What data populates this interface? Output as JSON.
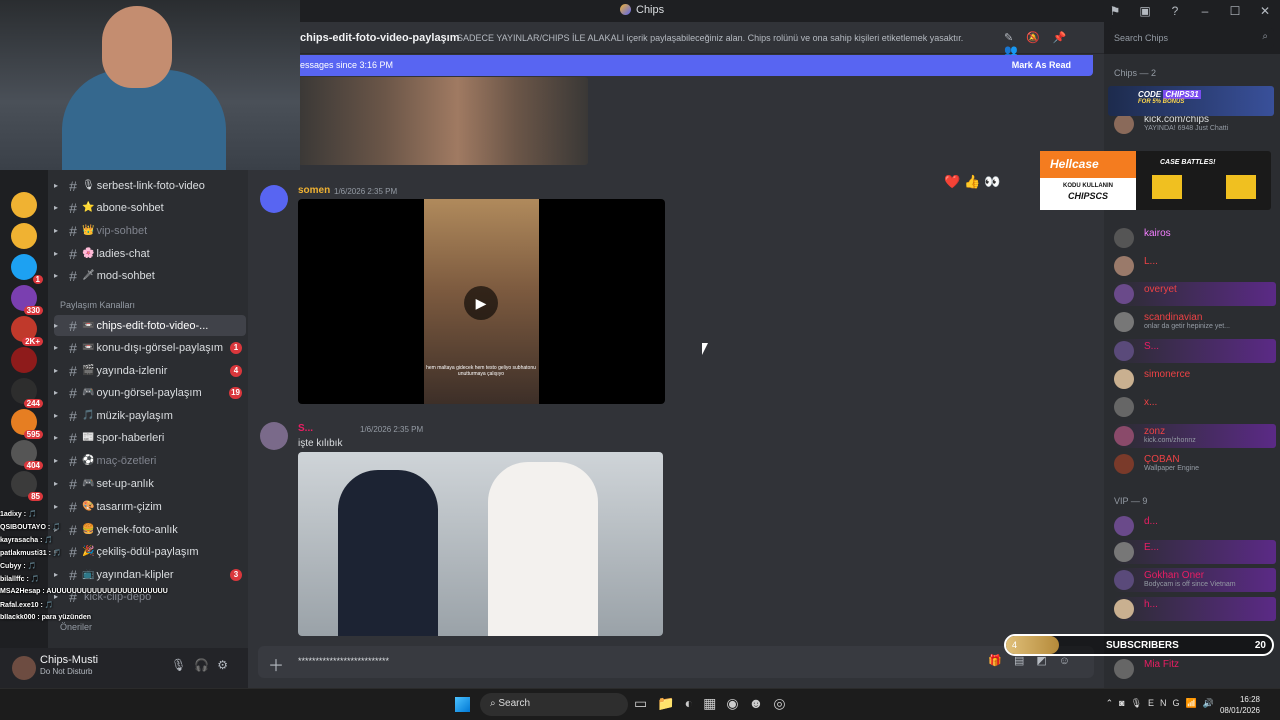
{
  "window": {
    "title": "Chips"
  },
  "header": {
    "channel_name": "chips-edit-foto-video-paylaşım",
    "topic": "SADECE YAYINLAR/CHIPS İLE ALAKALI içerik paylaşabileceğiniz alan. Chips rolünü ve ona sahip kişileri etiketlemek yasaktır.",
    "search_placeholder": "Search Chips"
  },
  "new_messages": {
    "label": "essages since 3:16 PM",
    "action": "Mark As Read"
  },
  "rail": [
    {
      "color": "#f0b232",
      "badge": ""
    },
    {
      "color": "#f0b232",
      "badge": ""
    },
    {
      "color": "#1da1f2",
      "badge": "1"
    },
    {
      "color": "#7a3fb0",
      "badge": "330"
    },
    {
      "color": "#c0392b",
      "badge": "2K+"
    },
    {
      "color": "#8e1b1b",
      "badge": ""
    },
    {
      "color": "#2d2d2d",
      "badge": "244"
    },
    {
      "color": "#e67e22",
      "badge": "595"
    },
    {
      "color": "#555555",
      "badge": "404"
    },
    {
      "color": "#3b3b3b",
      "badge": "85"
    }
  ],
  "channels": [
    {
      "emoji": "🎙",
      "name": "serbest-link-foto-video",
      "badge": "",
      "muted": false,
      "active": false
    },
    {
      "emoji": "⭐",
      "name": "abone-sohbet",
      "badge": "",
      "muted": false,
      "active": false
    },
    {
      "emoji": "👑",
      "name": "vip-sohbet",
      "badge": "",
      "muted": true,
      "active": false
    },
    {
      "emoji": "🌸",
      "name": "ladies-chat",
      "badge": "",
      "muted": false,
      "active": false
    },
    {
      "emoji": "🗡",
      "name": "mod-sohbet",
      "badge": "",
      "muted": false,
      "active": false
    },
    {
      "emoji": "📼",
      "name": "chips-edit-foto-video-...",
      "badge": "",
      "muted": false,
      "active": true
    },
    {
      "emoji": "📼",
      "name": "konu-dışı-görsel-paylaşım",
      "badge": "1",
      "muted": false,
      "active": false
    },
    {
      "emoji": "🎬",
      "name": "yayında-izlenir",
      "badge": "4",
      "muted": false,
      "active": false
    },
    {
      "emoji": "🎮",
      "name": "oyun-görsel-paylaşım",
      "badge": "19",
      "muted": false,
      "active": false
    },
    {
      "emoji": "🎵",
      "name": "müzik-paylaşım",
      "badge": "",
      "muted": false,
      "active": false
    },
    {
      "emoji": "📰",
      "name": "spor-haberleri",
      "badge": "",
      "muted": false,
      "active": false
    },
    {
      "emoji": "⚽",
      "name": "maç-özetleri",
      "badge": "",
      "muted": true,
      "active": false
    },
    {
      "emoji": "🎮",
      "name": "set-up-anlık",
      "badge": "",
      "muted": false,
      "active": false
    },
    {
      "emoji": "🎨",
      "name": "tasarım-çizim",
      "badge": "",
      "muted": false,
      "active": false
    },
    {
      "emoji": "🍔",
      "name": "yemek-foto-anlık",
      "badge": "",
      "muted": false,
      "active": false
    },
    {
      "emoji": "🎉",
      "name": "çekiliş-ödül-paylaşım",
      "badge": "",
      "muted": false,
      "active": false
    },
    {
      "emoji": "📺",
      "name": "yayından-klipler",
      "badge": "3",
      "muted": false,
      "active": false
    },
    {
      "emoji": "",
      "name": "kick-clip-depo",
      "badge": "",
      "muted": true,
      "active": false
    }
  ],
  "categories": {
    "share": "Paylaşım Kanalları",
    "suggestions": "Öneriler"
  },
  "user": {
    "name": "Chips-Musti",
    "status": "Do Not Disturb"
  },
  "messages": [
    {
      "author": "somen",
      "time": "1/6/2026 2:35 PM",
      "video_caption": "hem maltaya gidecek hem testo geliyo subhatonu unutturmaya çalışıyo"
    },
    {
      "author": "S...",
      "time": "1/6/2026 2:35 PM",
      "text": "işte kılıbık"
    }
  ],
  "reactions": [
    "❤️",
    "👍",
    "👀"
  ],
  "composer": {
    "text": "**************************"
  },
  "members": {
    "chips_category": "Chips — 2",
    "chips_members": [
      {
        "name": "kick.com/chips",
        "sub": "YAYINDA! 6948 Just Chatti",
        "color": "#dbdee1"
      }
    ],
    "online": [
      {
        "name": "kairos",
        "sub": "",
        "color": "#f47fff"
      },
      {
        "name": "L...",
        "sub": "",
        "color": "#ed4245"
      },
      {
        "name": "overyet",
        "sub": "",
        "color": "#ed4245"
      },
      {
        "name": "scandinavian",
        "sub": "onlar da getir hepinize yet...",
        "color": "#ed4245"
      },
      {
        "name": "S...",
        "sub": "",
        "color": "#e91e63"
      },
      {
        "name": "simonerce",
        "sub": "",
        "color": "#ed4245"
      },
      {
        "name": "x...",
        "sub": "",
        "color": "#ed4245"
      },
      {
        "name": "zonz",
        "sub": "kick.com/zhonnz",
        "color": "#ed4245"
      },
      {
        "name": "ÇOBAN",
        "sub": "Wallpaper Engine",
        "color": "#ed4245"
      }
    ],
    "vip_category": "VIP — 9",
    "vip_members": [
      {
        "name": "d...",
        "sub": "",
        "color": "#e91e63"
      },
      {
        "name": "E...",
        "sub": "",
        "color": "#e91e63"
      },
      {
        "name": "Gokhan Oner",
        "sub": "Bodycam is off since Vietnam",
        "color": "#e91e63"
      },
      {
        "name": "h...",
        "sub": "",
        "color": "#e91e63"
      },
      {
        "name": "Mia Fitz",
        "sub": "",
        "color": "#e91e63"
      }
    ]
  },
  "ad": {
    "brand": "Hellcase",
    "code_label": "KODU KULLANIN",
    "code": "CHIPSCS",
    "title": "CASE BATTLES!"
  },
  "code_banner": {
    "code_label": "CODE",
    "code": "CHIPS31",
    "bonus": "FOR 5% BONUS"
  },
  "chat_overlay": [
    "1adixy : 🎵",
    "QSIBOUTAYO : 🎵",
    "kayrasacha : 🎵",
    "patlakmusti31 : 🎵",
    "Cubyy : 🎵",
    "bilallffc : 🎵",
    "MSA2Hesap : AUUUUUUUUUUUUUUUUUUUUUUU",
    "Rafal.exe10 : 🎵",
    "bllackk000 : para yüzünden"
  ],
  "subs": {
    "label": "SUBSCRIBERS",
    "current": "4",
    "goal": "20",
    "fraction": 0.2
  },
  "taskbar": {
    "search": "Search",
    "lang": "ENG",
    "time": "16:28",
    "date": "08/01/2026"
  }
}
